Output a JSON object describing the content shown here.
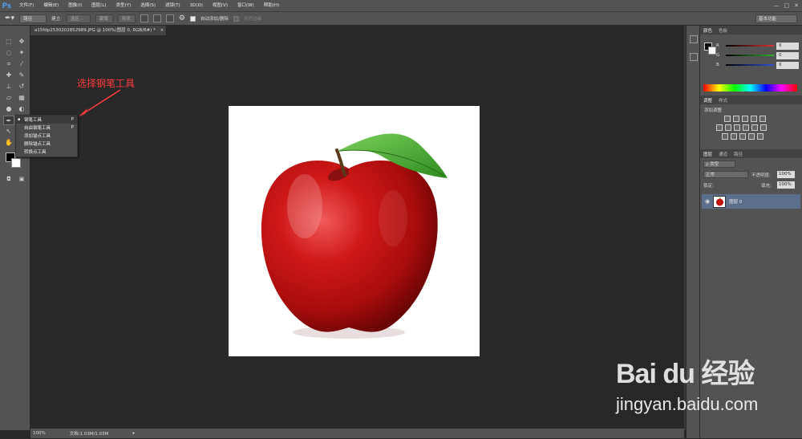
{
  "app": {
    "logo": "Ps"
  },
  "menu": [
    "文件(F)",
    "编辑(E)",
    "图像(I)",
    "图层(L)",
    "类型(Y)",
    "选择(S)",
    "滤镜(T)",
    "3D(D)",
    "视图(V)",
    "窗口(W)",
    "帮助(H)"
  ],
  "window_controls": [
    "—",
    "□",
    "✕"
  ],
  "options": {
    "mode": "路径",
    "make_label": "建立:",
    "selection_btn": "选区...",
    "mask_btn": "蒙版",
    "shape_btn": "形状",
    "auto_add_label": "自动添加/删除",
    "align_edges_label": "对齐边缘",
    "workspace": "基本功能"
  },
  "document": {
    "tab_title": "a15fdp2530202852989.JPG @ 100%(图层 0, RGB/8#) *",
    "zoom": "100%",
    "doc_size": "文档:1.03M/1.03M"
  },
  "flyout": {
    "items": [
      {
        "label": "钢笔工具",
        "shortcut": "P"
      },
      {
        "label": "自由钢笔工具",
        "shortcut": "P"
      },
      {
        "label": "添加锚点工具",
        "shortcut": ""
      },
      {
        "label": "删除锚点工具",
        "shortcut": ""
      },
      {
        "label": "转换点工具",
        "shortcut": ""
      }
    ]
  },
  "annotation": {
    "text": "选择钢笔工具",
    "color": "#ff3b3b"
  },
  "color_panel": {
    "tabs": [
      "颜色",
      "色板"
    ],
    "rows": [
      {
        "channel": "R",
        "value": "0",
        "color": "#e03030"
      },
      {
        "channel": "G",
        "value": "0",
        "color": "#30b030"
      },
      {
        "channel": "B",
        "value": "0",
        "color": "#3050e0"
      }
    ]
  },
  "adjust_panel": {
    "tabs": [
      "调整",
      "样式"
    ],
    "title": "添加调整"
  },
  "layers_panel": {
    "tabs": [
      "图层",
      "通道",
      "路径"
    ],
    "filter": "ρ 类型",
    "blend": "正常",
    "opacity_label": "不透明度:",
    "opacity": "100%",
    "lock_label": "锁定:",
    "fill_label": "填充:",
    "fill": "100%",
    "layers": [
      {
        "name": "图层 0"
      }
    ]
  },
  "watermark": {
    "main": "Bai du 经验",
    "sub": "jingyan.baidu.com"
  }
}
